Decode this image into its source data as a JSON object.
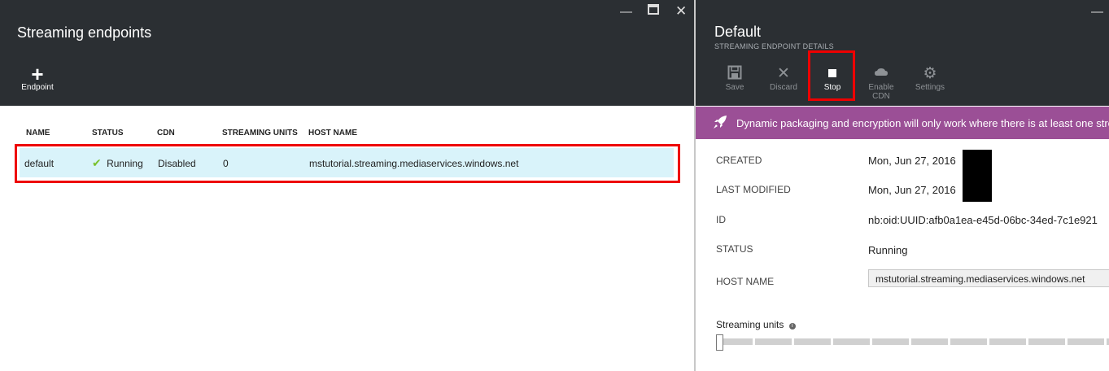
{
  "left_blade": {
    "title": "Streaming endpoints",
    "add_button": {
      "label": "Endpoint",
      "icon": "plus-icon"
    },
    "columns": [
      "NAME",
      "STATUS",
      "CDN",
      "STREAMING UNITS",
      "HOST NAME"
    ],
    "rows": [
      {
        "name": "default",
        "status": "Running",
        "cdn": "Disabled",
        "units": "0",
        "host": "mstutorial.streaming.mediaservices.windows.net"
      }
    ]
  },
  "right_blade": {
    "title": "Default",
    "subtitle": "STREAMING ENDPOINT DETAILS",
    "toolbar": {
      "save": "Save",
      "discard": "Discard",
      "stop": "Stop",
      "enable_cdn_line1": "Enable",
      "enable_cdn_line2": "CDN",
      "settings": "Settings"
    },
    "banner": "Dynamic packaging and encryption will only work where there is at least one streaming unit.",
    "fields": {
      "created_label": "CREATED",
      "created_value": "Mon, Jun 27, 2016",
      "modified_label": "LAST MODIFIED",
      "modified_value": "Mon, Jun 27, 2016",
      "id_label": "ID",
      "id_value": "nb:oid:UUID:afb0a1ea-e45d-06bc-34ed-7c1e921",
      "status_label": "STATUS",
      "status_value": "Running",
      "host_label": "HOST NAME",
      "host_value": "mstutorial.streaming.mediaservices.windows.net"
    },
    "streaming_units_label": "Streaming units",
    "streaming_units_value": 0
  },
  "colors": {
    "header_bg": "#2b2f33",
    "banner": "#9b4f96",
    "selected_row": "#d9f3fa",
    "highlight": "#e00000",
    "check": "#7ac12e"
  }
}
